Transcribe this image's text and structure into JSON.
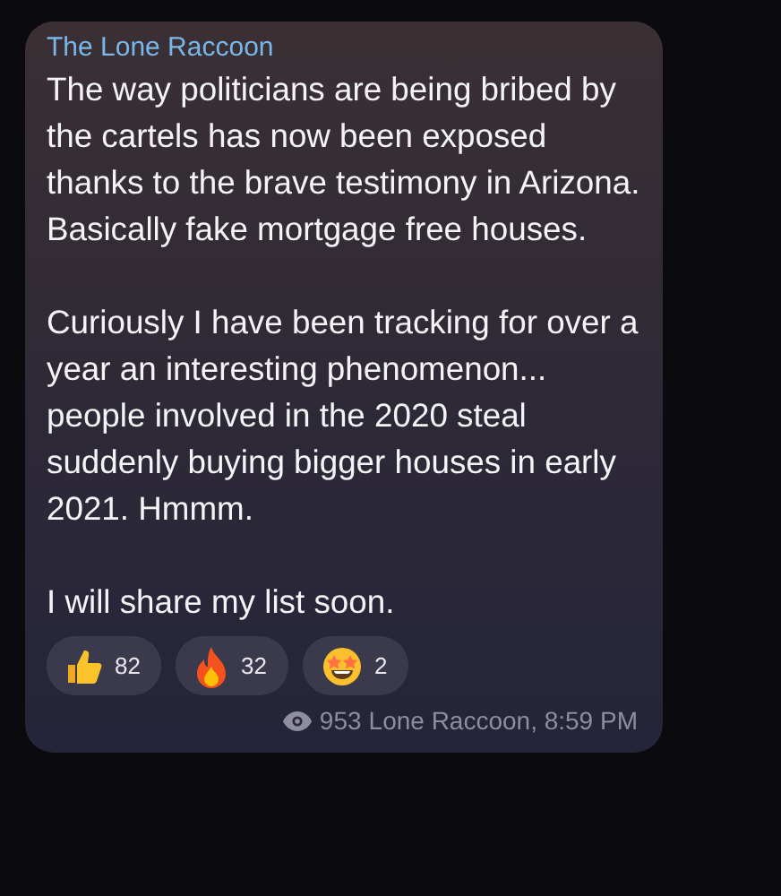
{
  "message": {
    "sender": "The Lone Raccoon",
    "paragraphs": [
      "The way politicians are being bribed by the cartels has now been exposed thanks to the brave testimony in Arizona. Basically fake mortgage free houses.",
      "Curiously I have been tracking for over a year an interesting phenomenon... people involved in the 2020 steal suddenly buying bigger houses in early 2021. Hmmm.",
      "I will share my list soon."
    ],
    "reactions": [
      {
        "kind": "thumbs-up",
        "count": "82"
      },
      {
        "kind": "fire",
        "count": "32"
      },
      {
        "kind": "star-struck",
        "count": "2"
      }
    ],
    "views": "953",
    "footer": "Lone Raccoon, 8:59 PM"
  }
}
